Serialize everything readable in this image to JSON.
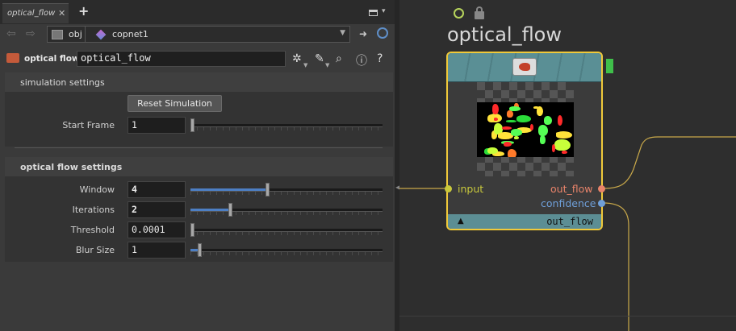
{
  "tabs": [
    {
      "label": "optical_flow"
    }
  ],
  "path": {
    "segments": [
      "obj",
      "copnet1"
    ]
  },
  "operator": {
    "type_label": "optical flow",
    "name": "optical_flow"
  },
  "sections": {
    "simulation": {
      "title": "simulation settings",
      "reset_button": "Reset Simulation",
      "start_frame": {
        "label": "Start Frame",
        "value": "1",
        "slider_fraction": 0.0
      }
    },
    "optical_flow": {
      "title": "optical flow settings",
      "params": [
        {
          "label": "Window",
          "value": "4",
          "slider_fraction": 0.4,
          "bold": true
        },
        {
          "label": "Iterations",
          "value": "2",
          "slider_fraction": 0.2,
          "bold": true
        },
        {
          "label": "Threshold",
          "value": "0.0001",
          "slider_fraction": 0.0,
          "bold": false
        },
        {
          "label": "Blur Size",
          "value": "1",
          "slider_fraction": 0.04,
          "bold": false
        }
      ]
    }
  },
  "network": {
    "node_name": "optical_flow",
    "inputs": [
      {
        "label": "input"
      }
    ],
    "outputs": [
      {
        "label": "out_flow"
      },
      {
        "label": "confidence"
      }
    ],
    "footer_output": "out_flow",
    "footer_bypass": "▲"
  },
  "colors": {
    "selected_border": "#f0c93a",
    "node_header": "#5a8f95",
    "input_port": "#c8c83c",
    "out_flow_port": "#e8836a",
    "confidence_port": "#6f9fd8",
    "wire": "#c9a94a",
    "slider_fill": "#4d7fc4"
  },
  "icons": [
    "back-arrow-icon",
    "forward-arrow-icon",
    "obj-icon",
    "copnet-icon",
    "pin-icon",
    "link-icon",
    "gear-icon",
    "brush-icon",
    "magnifier-icon",
    "info-icon",
    "help-icon",
    "clock-icon",
    "lock-icon"
  ]
}
